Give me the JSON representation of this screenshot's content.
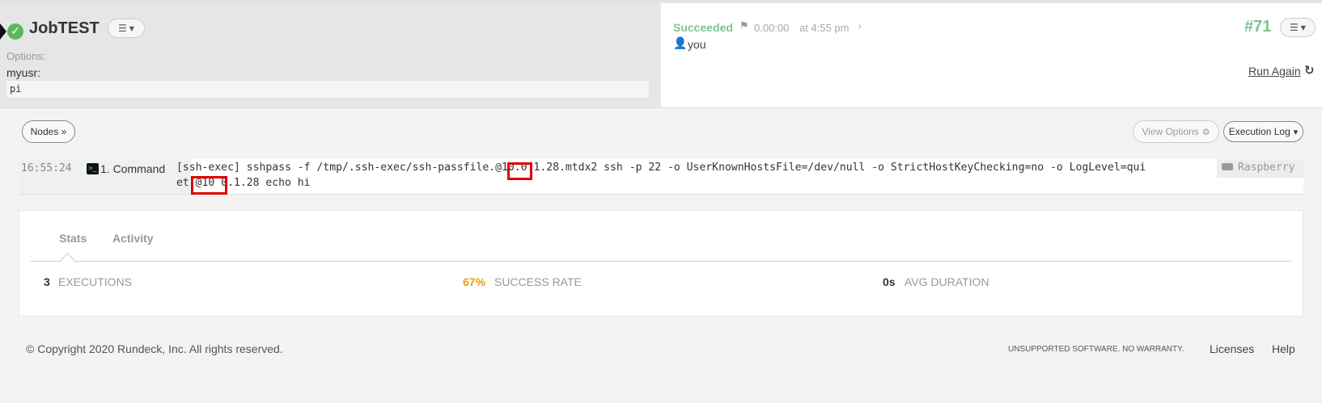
{
  "job": {
    "title": "JobTEST",
    "options_label": "Options:",
    "option_name": "myusr:",
    "option_value": "pi"
  },
  "execution": {
    "status": "Succeeded",
    "duration": "0.00:00",
    "time": "at 4:55 pm",
    "user": "you",
    "number": "#71",
    "run_again": "Run Again"
  },
  "toolbar": {
    "nodes": "Nodes »",
    "view_options": "View Options",
    "execution_log": "Execution Log"
  },
  "log": {
    "time": "16:55:24",
    "step": "1. Command",
    "line1": "[ssh-exec] sshpass -f /tmp/.ssh-exec/ssh-passfile.@10.0.1.28.mtdx2 ssh -p 22 -o UserKnownHostsFile=/dev/null -o StrictHostKeyChecking=no -o LogLevel=qui",
    "line2": "et  @10 0.1.28 echo hi",
    "node": "Raspberry"
  },
  "stats": {
    "tabs": [
      "Stats",
      "Activity"
    ],
    "executions_value": "3",
    "executions_label": "EXECUTIONS",
    "success_value": "67%",
    "success_label": "SUCCESS RATE",
    "avg_value": "0s",
    "avg_label": "AVG DURATION"
  },
  "footer": {
    "copyright": "© Copyright 2020 Rundeck, Inc. All rights reserved.",
    "warning": "UNSUPPORTED SOFTWARE. NO WARRANTY.",
    "licenses": "Licenses",
    "help": "Help"
  },
  "colors": {
    "success_green": "#7fc28c",
    "warning_orange": "#e6a012",
    "highlight_red": "#e00000"
  },
  "icons": [
    "check-icon",
    "list-icon",
    "flag-icon",
    "chevron-right-icon",
    "user-icon",
    "refresh-icon",
    "gear-icon",
    "terminal-icon",
    "server-icon"
  ]
}
